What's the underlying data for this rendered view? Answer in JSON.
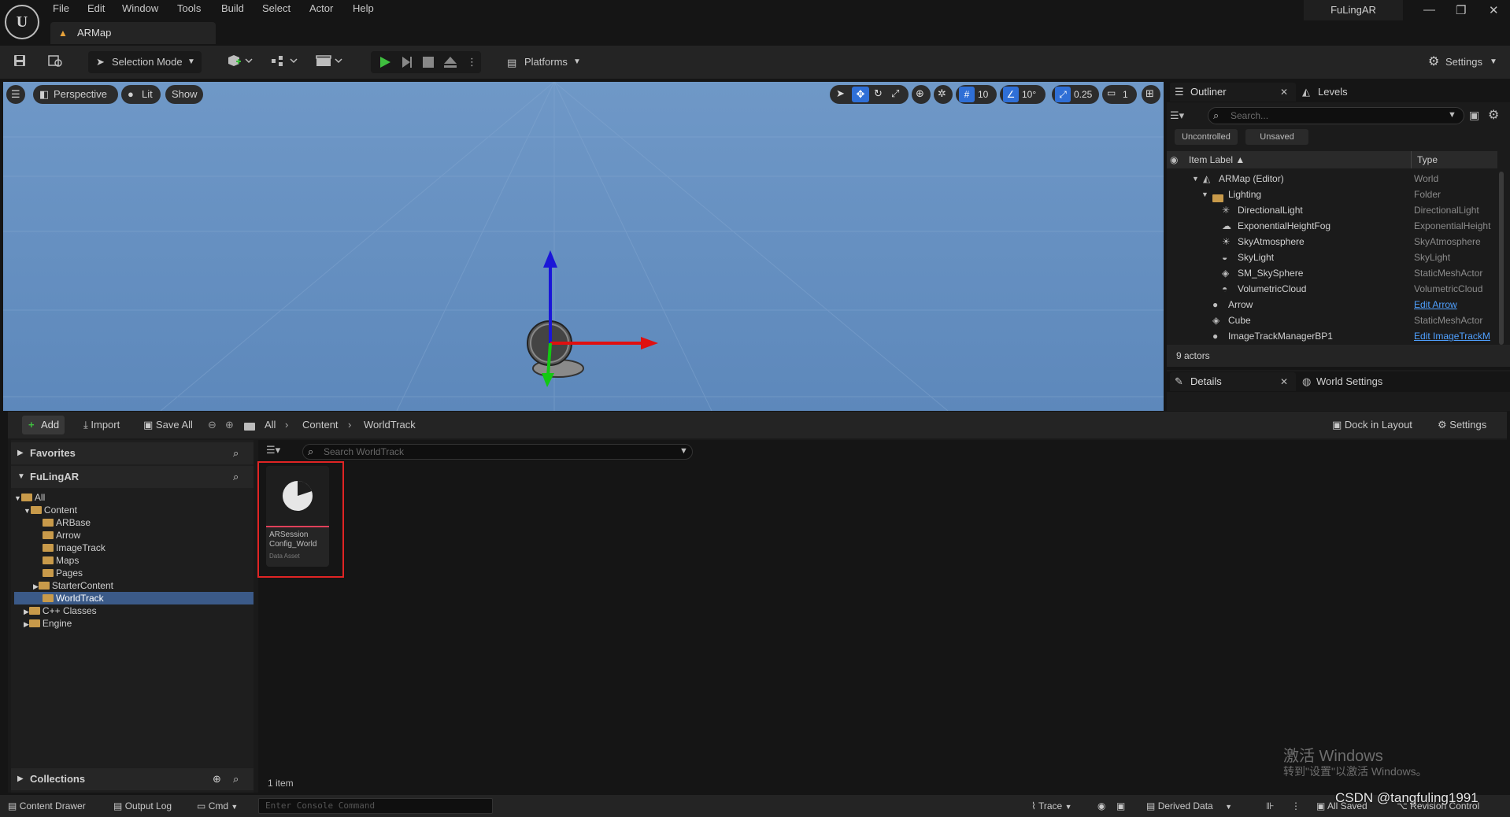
{
  "app": {
    "logo_text": "U",
    "menu": [
      "File",
      "Edit",
      "Window",
      "Tools",
      "Build",
      "Select",
      "Actor",
      "Help"
    ],
    "map_tab": "ARMap",
    "project_name": "FuLingAR",
    "window_controls": {
      "minimize": "—",
      "restore": "❐",
      "close": "✕"
    }
  },
  "toolbar": {
    "selection_mode": "Selection Mode",
    "platforms": "Platforms",
    "settings": "Settings"
  },
  "viewport": {
    "perspective": "Perspective",
    "lit": "Lit",
    "show": "Show",
    "grid_snap": "10",
    "rotation_snap": "10°",
    "scale_snap": "0.25",
    "camera_speed": "1"
  },
  "outliner": {
    "tab": "Outliner",
    "levels_tab": "Levels",
    "search_placeholder": "Search...",
    "filter_uncontrolled": "Uncontrolled",
    "filter_unsaved": "Unsaved",
    "col_label": "Item Label ▲",
    "col_type": "Type",
    "rows": [
      {
        "name": "ARMap (Editor)",
        "type": "World"
      },
      {
        "name": "Lighting",
        "type": "Folder"
      },
      {
        "name": "DirectionalLight",
        "type": "DirectionalLight"
      },
      {
        "name": "ExponentialHeightFog",
        "type": "ExponentialHeight"
      },
      {
        "name": "SkyAtmosphere",
        "type": "SkyAtmosphere"
      },
      {
        "name": "SkyLight",
        "type": "SkyLight"
      },
      {
        "name": "SM_SkySphere",
        "type": "StaticMeshActor"
      },
      {
        "name": "VolumetricCloud",
        "type": "VolumetricCloud"
      },
      {
        "name": "Arrow",
        "type": "Edit Arrow"
      },
      {
        "name": "Cube",
        "type": "StaticMeshActor"
      },
      {
        "name": "ImageTrackManagerBP1",
        "type": "Edit ImageTrackM"
      }
    ],
    "actor_count": "9 actors"
  },
  "details": {
    "tab": "Details",
    "world_settings_tab": "World Settings"
  },
  "content_browser": {
    "add": "Add",
    "import": "Import",
    "save_all": "Save All",
    "breadcrumb": [
      "All",
      "Content",
      "WorldTrack"
    ],
    "dock_in_layout": "Dock in Layout",
    "settings": "Settings",
    "favorites": "Favorites",
    "project": "FuLingAR",
    "tree": {
      "all": "All",
      "content": "Content",
      "folders": [
        "ARBase",
        "Arrow",
        "ImageTrack",
        "Maps",
        "Pages",
        "StarterContent",
        "WorldTrack"
      ],
      "cpp": "C++ Classes",
      "engine": "Engine"
    },
    "collections": "Collections",
    "search_placeholder": "Search WorldTrack",
    "asset": {
      "name_line1": "ARSession",
      "name_line2": "Config_World",
      "kind": "Data Asset"
    },
    "item_count": "1 item"
  },
  "statusbar": {
    "content_drawer": "Content Drawer",
    "output_log": "Output Log",
    "cmd": "Cmd",
    "console_placeholder": "Enter Console Command",
    "trace": "Trace",
    "derived_data": "Derived Data",
    "all_saved": "All Saved",
    "revision_control": "Revision Control"
  },
  "overlays": {
    "activate_title": "激活 Windows",
    "activate_sub": "转到\"设置\"以激活 Windows。",
    "watermark": "CSDN @tangfuling1991"
  },
  "colors": {
    "accent_link": "#4fa0ff",
    "highlight_box": "#e02424",
    "play_green": "#3fbf3f"
  }
}
